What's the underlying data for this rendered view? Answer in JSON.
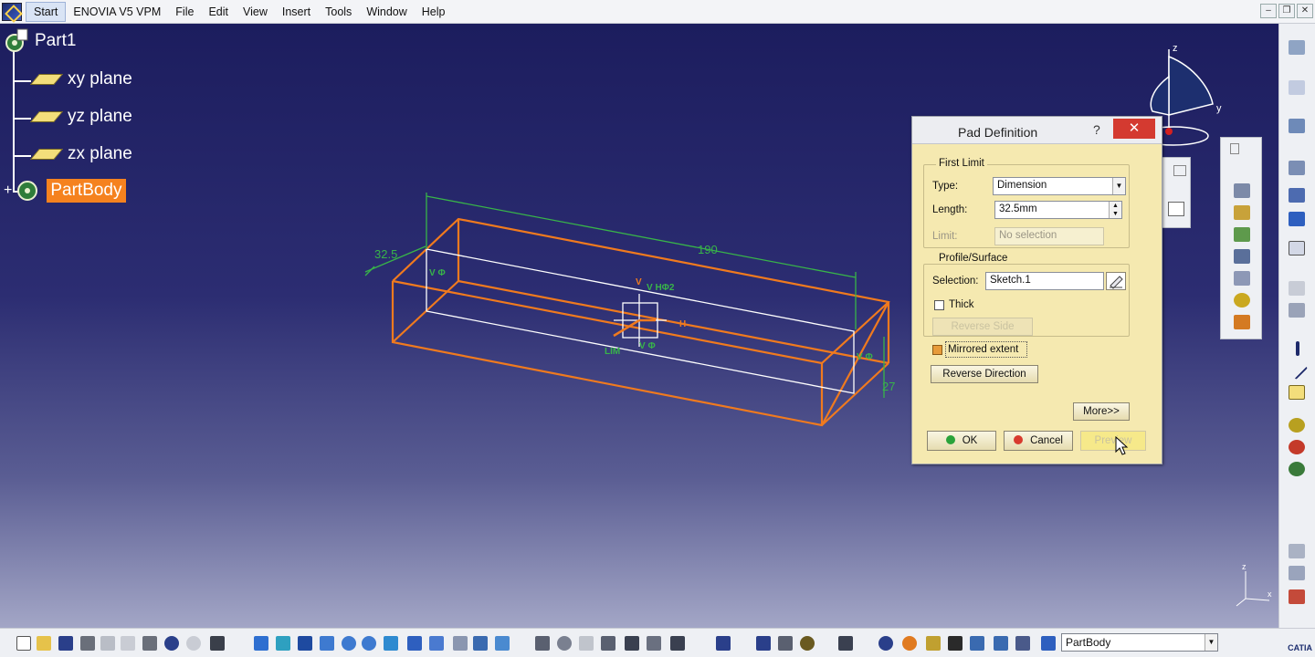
{
  "menubar": {
    "items": [
      "Start",
      "ENOVIA V5 VPM",
      "File",
      "Edit",
      "View",
      "Insert",
      "Tools",
      "Window",
      "Help"
    ]
  },
  "tree": {
    "root": "Part1",
    "items": [
      "xy plane",
      "yz plane",
      "zx plane"
    ],
    "partbody": "PartBody"
  },
  "viewport": {
    "dim_length": "190",
    "dim_width": "32.5",
    "dim_height": "27"
  },
  "compass": {
    "z": "z",
    "y": "y"
  },
  "dialog": {
    "title": "Pad Definition",
    "help": "?",
    "close": "✕",
    "first_limit": {
      "title": "First Limit",
      "type_label": "Type:",
      "type_value": "Dimension",
      "length_label": "Length:",
      "length_value": "32.5mm",
      "limit_label": "Limit:",
      "limit_value": "No selection"
    },
    "profile": {
      "title": "Profile/Surface",
      "selection_label": "Selection:",
      "selection_value": "Sketch.1",
      "thick_label": "Thick",
      "reverse_side": "Reverse Side"
    },
    "mirrored_extent": "Mirrored extent",
    "reverse_direction": "Reverse Direction",
    "more": "More>>",
    "ok": "OK",
    "cancel": "Cancel",
    "preview": "Preview"
  },
  "axis_triad": {
    "z": "z",
    "x": "x"
  },
  "bottom": {
    "current_body": "PartBody"
  },
  "catia": "CATIA",
  "colors": {
    "viewport_top": "#1c1d5e",
    "pad_orange": "#f07a1e",
    "dim_green": "#38b449",
    "dialog_bg": "#f5e9b0",
    "selected_orange": "#f5821f"
  }
}
